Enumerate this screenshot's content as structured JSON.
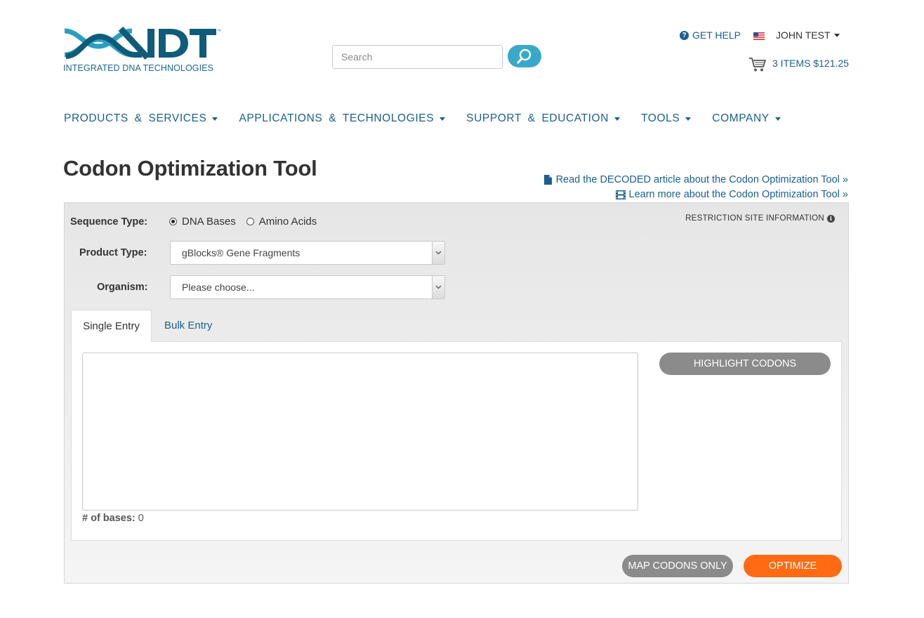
{
  "header": {
    "logo_text": "INTEGRATED DNA TECHNOLOGIES",
    "search_placeholder": "Search",
    "get_help": "GET HELP",
    "user_name": "JOHN TEST",
    "cart_label": "3 ITEMS $121.25"
  },
  "nav": {
    "items": [
      {
        "label": "PRODUCTS & SERVICES"
      },
      {
        "label": "APPLICATIONS & TECHNOLOGIES"
      },
      {
        "label": "SUPPORT & EDUCATION"
      },
      {
        "label": "TOOLS"
      },
      {
        "label": "COMPANY"
      }
    ]
  },
  "page": {
    "title": "Codon Optimization Tool",
    "decoded_link": "Read the DECODED article about the Codon Optimization Tool »",
    "learn_link": "Learn more about the Codon Optimization Tool »"
  },
  "form": {
    "sequence_type_label": "Sequence Type:",
    "option_dna": "DNA Bases",
    "option_amino": "Amino Acids",
    "restriction_info": "RESTRICTION SITE INFORMATION",
    "product_type_label": "Product Type:",
    "product_type_value": "gBlocks® Gene Fragments",
    "organism_label": "Organism:",
    "organism_value": "Please choose...",
    "tab_single": "Single Entry",
    "tab_bulk": "Bulk Entry",
    "bases_label": "# of bases:",
    "bases_count": "0",
    "highlight_button": "HIGHLIGHT CODONS",
    "map_button": "MAP CODONS ONLY",
    "optimize_button": "OPTIMIZE"
  },
  "colors": {
    "brand_blue": "#1a5f8f",
    "search_button": "#3aa9c9",
    "optimize_orange": "#ff6a13",
    "gray_button": "#8b8b8b"
  }
}
